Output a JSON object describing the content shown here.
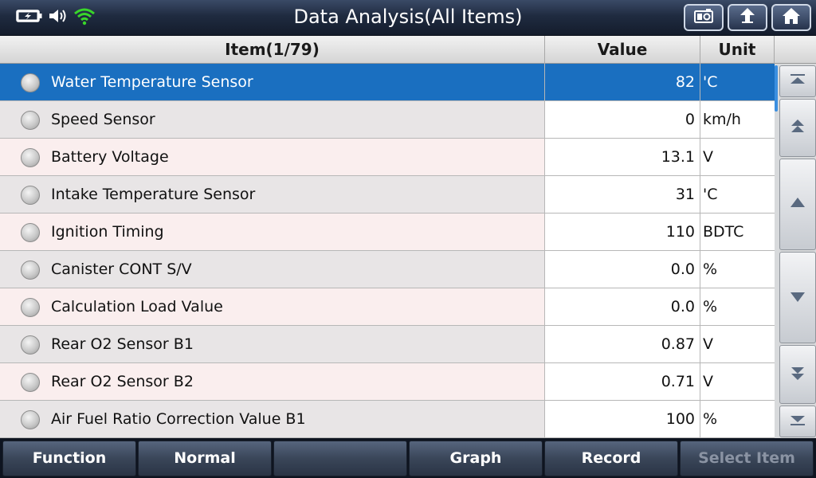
{
  "header": {
    "title": "Data Analysis(All Items)"
  },
  "table": {
    "columns": {
      "item": "Item(1/79)",
      "value": "Value",
      "unit": "Unit"
    },
    "rows": [
      {
        "name": "Water Temperature Sensor",
        "value": "82",
        "unit": "'C",
        "selected": true
      },
      {
        "name": "Speed Sensor",
        "value": "0",
        "unit": "km/h"
      },
      {
        "name": "Battery Voltage",
        "value": "13.1",
        "unit": "V"
      },
      {
        "name": "Intake Temperature Sensor",
        "value": "31",
        "unit": "'C"
      },
      {
        "name": "Ignition Timing",
        "value": "110",
        "unit": "BDTC"
      },
      {
        "name": "Canister CONT S/V",
        "value": "0.0",
        "unit": "%"
      },
      {
        "name": "Calculation Load Value",
        "value": "0.0",
        "unit": "%"
      },
      {
        "name": "Rear O2 Sensor B1",
        "value": "0.87",
        "unit": "V"
      },
      {
        "name": "Rear O2 Sensor B2",
        "value": "0.71",
        "unit": "V"
      },
      {
        "name": "Air Fuel Ratio Correction Value B1",
        "value": "100",
        "unit": "%"
      }
    ]
  },
  "toolbar": {
    "function_label": "Function",
    "normal_label": "Normal",
    "blank_label": "",
    "graph_label": "Graph",
    "record_label": "Record",
    "select_item_label": "Select Item"
  },
  "icons": {
    "battery": "battery-charging-icon",
    "volume": "speaker-icon",
    "wifi": "wifi-icon",
    "screenshot": "camera-icon",
    "back": "back-arrow-icon",
    "home": "home-icon"
  },
  "colors": {
    "selected_row": "#1a6fc0",
    "wifi": "#39d62a"
  }
}
